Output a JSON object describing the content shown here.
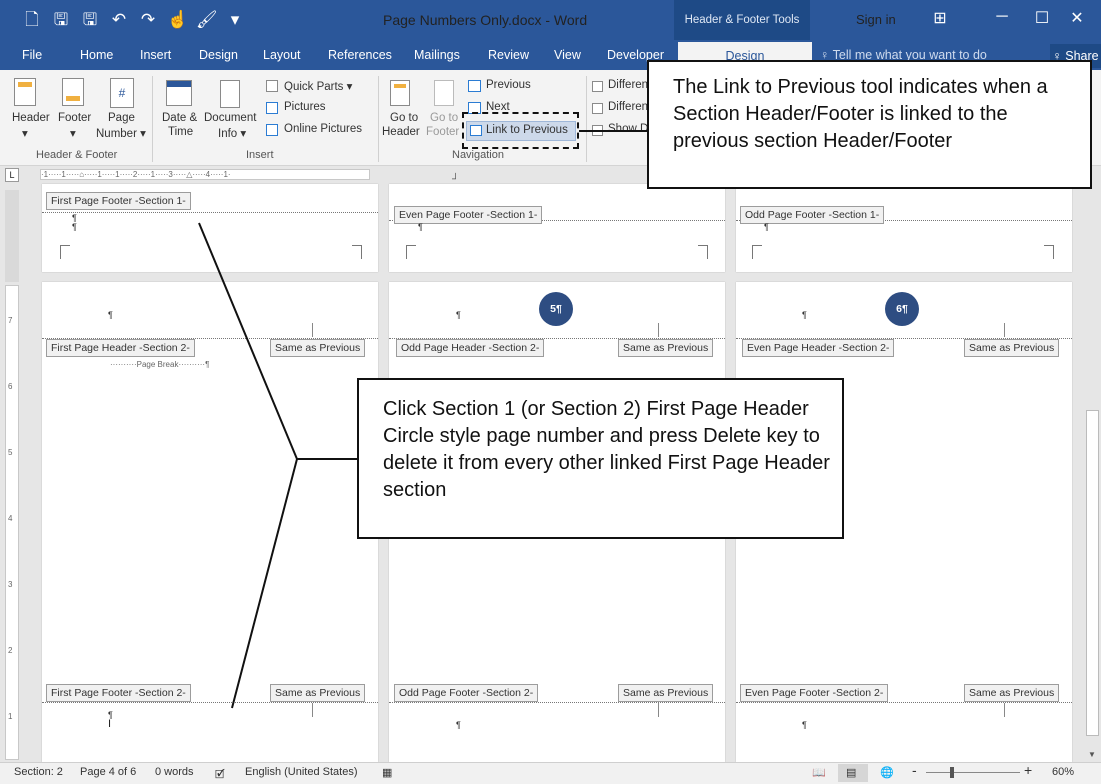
{
  "titlebar": {
    "qat_icons": [
      "new-doc-icon",
      "save-icon",
      "save-as-icon",
      "undo-icon",
      "redo-icon",
      "touch-mode-icon",
      "format-painter-icon",
      "customize-icon"
    ],
    "qat_glyphs": [
      "🗋",
      "🖫",
      "🖫",
      "↶",
      "↷",
      "☝",
      "🖌",
      "▾"
    ],
    "doc_title": "Page Numbers Only.docx  -  Word",
    "context_tab": "Header & Footer Tools",
    "sign_in": "Sign in",
    "ribbon_display_glyph": "⊞",
    "minimize_glyph": "─",
    "maximize_glyph": "☐",
    "close_glyph": "✕"
  },
  "tabs": {
    "file": "File",
    "home": "Home",
    "insert": "Insert",
    "design": "Design",
    "layout": "Layout",
    "references": "References",
    "mailings": "Mailings",
    "review": "Review",
    "view": "View",
    "developer": "Developer",
    "hf_design": "Design",
    "tell_me": "♀ Tell me what you want to do",
    "share": "♀ Share"
  },
  "ribbon": {
    "header_btn": "Header",
    "footer_btn": "Footer",
    "page_number_btn_1": "Page",
    "page_number_btn_2": "Number ▾",
    "hf_dropdown_1": "▾",
    "hf_dropdown_2": "▾",
    "group_header_footer": "Header & Footer",
    "date_time_1": "Date &",
    "date_time_2": "Time",
    "document_info_1": "Document",
    "document_info_2": "Info ▾",
    "quick_parts": "Quick Parts ▾",
    "pictures": "Pictures",
    "online_pictures": "Online Pictures",
    "group_insert": "Insert",
    "goto_header_1": "Go to",
    "goto_header_2": "Header",
    "goto_footer_1": "Go to",
    "goto_footer_2": "Footer",
    "previous": "Previous",
    "next": "Next",
    "link_to_previous": "Link to Previous",
    "group_navigation": "Navigation",
    "option_1": "Differen",
    "option_2": "Differen",
    "option_3": "Show D"
  },
  "ruler": {
    "tab_selector": "L",
    "marks": "·1·····1·····⌂·····1·····1·····2·····1·····3·····△·····4·····1·"
  },
  "pages": {
    "row1": {
      "p1_label": "First Page Footer -Section 1-",
      "p2_label": "Even Page Footer -Section 1-",
      "p3_label": "Odd Page Footer -Section 1-"
    },
    "row2": {
      "p1_header": "First Page Header -Section 2-",
      "p1_same": "Same as Previous",
      "page_break": "··········Page Break··········¶",
      "p2_header": "Odd Page Header -Section 2-",
      "p2_same": "Same as Previous",
      "p2_number": "5¶",
      "p3_header": "Even Page Header -Section 2-",
      "p3_same": "Same as Previous",
      "p3_number": "6¶",
      "p1_footer": "First Page Footer -Section 2-",
      "p1_footer_same": "Same as Previous",
      "p2_footer": "Odd Page Footer -Section 2-",
      "p2_footer_same": "Same as Previous",
      "p3_footer": "Even Page Footer -Section 2-",
      "p3_footer_same": "Same as Previous",
      "pilcrow": "¶",
      "cursor": "I"
    }
  },
  "vruler_numbers": [
    "7",
    "6",
    "5",
    "4",
    "3",
    "2",
    "1"
  ],
  "status": {
    "section": "Section: 2",
    "page": "Page 4 of 6",
    "words": "0 words",
    "proofing_glyph": "🗹",
    "language": "English (United States)",
    "macro_glyph": "▦",
    "view_read_glyph": "📖",
    "view_print_glyph": "▤",
    "view_web_glyph": "🌐",
    "zoom_minus": "-",
    "zoom_plus": "+",
    "zoom": "60%"
  },
  "callouts": {
    "top": "The Link to Previous tool indicates when a Section Header/Footer is linked to the previous section Header/Footer",
    "middle": "Click  Section 1 (or Section 2) First Page Header Circle style page number and press Delete key to delete it from every other linked First Page Header section"
  },
  "zoom_level": 0.6
}
